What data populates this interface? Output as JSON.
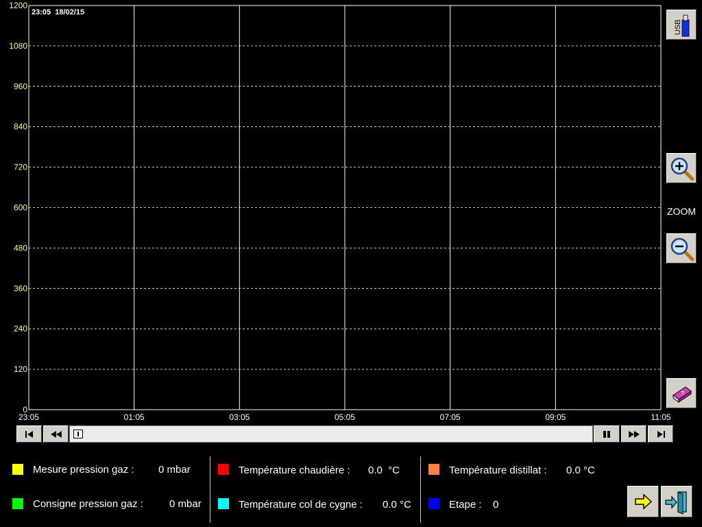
{
  "chart_data": {
    "type": "line",
    "title": "",
    "timestamp": "23:05  18/02/15",
    "y_ticks": [
      "1200",
      "1080",
      "960",
      "840",
      "720",
      "600",
      "480",
      "360",
      "240",
      "120",
      "0"
    ],
    "x_ticks": [
      "23:05",
      "01:05",
      "03:05",
      "05:05",
      "07:05",
      "09:05",
      "11:05"
    ],
    "ylim": [
      0,
      1200
    ],
    "grid": true,
    "series": []
  },
  "side": {
    "usb_label": "USB",
    "zoom_label": "ZOOM"
  },
  "legend": {
    "mesure_pression": {
      "label": "Mesure pression gaz :",
      "value": "0 mbar",
      "color": "#ffff00"
    },
    "consigne_pression": {
      "label": "Consigne pression gaz :",
      "value": "0 mbar",
      "color": "#00ff00"
    },
    "temp_chaudiere": {
      "label": "Température chaudière :",
      "value": "0.0  °C",
      "color": "#ff0000"
    },
    "temp_col_cygne": {
      "label": "Température col de cygne :",
      "value": "0.0 °C",
      "color": "#00ffff"
    },
    "temp_distillat": {
      "label": "Température distillat :",
      "value": "0.0 °C",
      "color": "#ff8040"
    },
    "etape": {
      "label": "Etape :",
      "value": "0",
      "color": "#0000ff"
    }
  },
  "colors": {
    "axis_label": "#ffff80",
    "grid": "#ffffff",
    "button_face": "#d4d0c8"
  }
}
